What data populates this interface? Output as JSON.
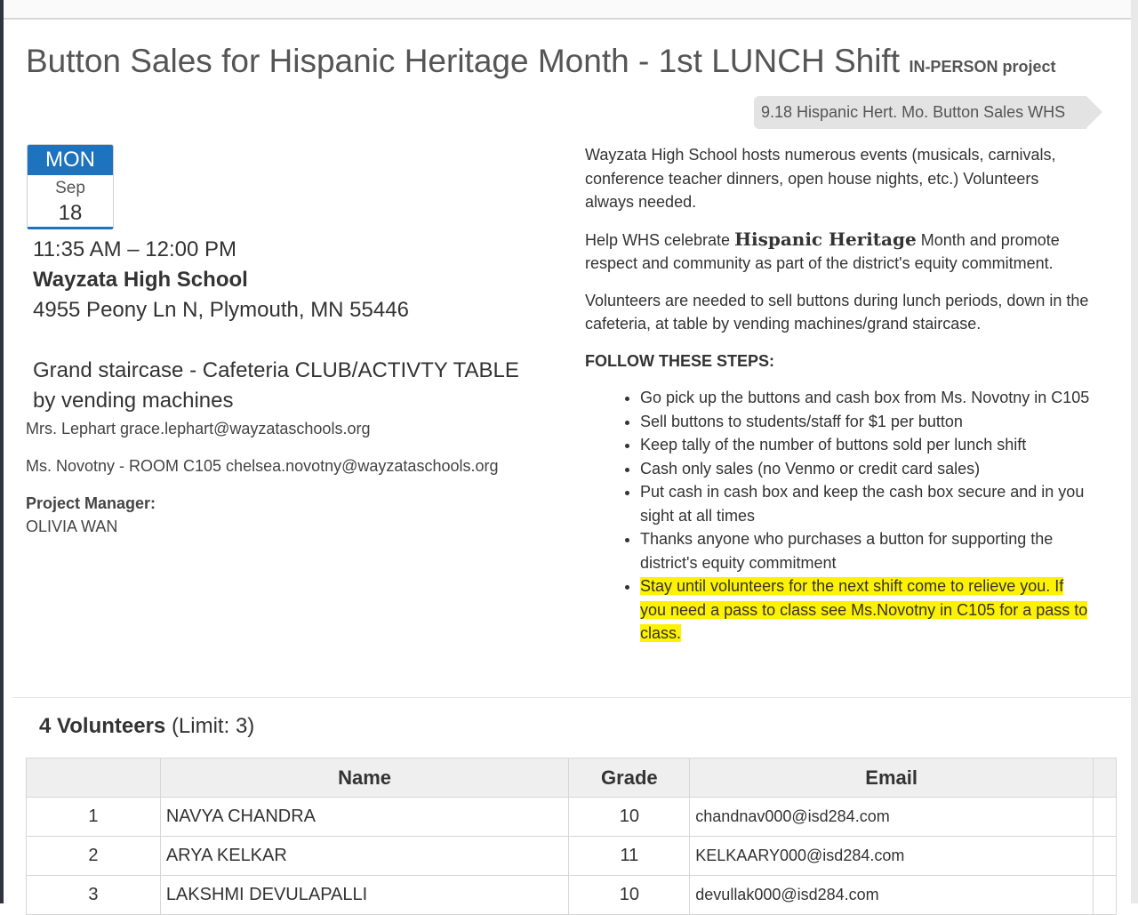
{
  "header": {
    "title": "Button Sales for Hispanic Heritage Month - 1st LUNCH Shift",
    "type_label": "IN-PERSON project",
    "event_tag": "9.18 Hispanic Hert. Mo. Button Sales WHS"
  },
  "date": {
    "day_of_week": "MON",
    "month": "Sep",
    "day": "18"
  },
  "details": {
    "time": "11:35 AM – 12:00 PM",
    "venue": "Wayzata High School",
    "address": "4955 Peony Ln N, Plymouth, MN 55446",
    "location_line1": "Grand staircase - Cafeteria CLUB/ACTIVTY TABLE",
    "location_line2": "by vending machines",
    "contact1": "Mrs. Lephart  grace.lephart@wayzataschools.org",
    "contact2": "Ms. Novotny - ROOM C105  chelsea.novotny@wayzataschools.org",
    "project_manager_label": "Project Manager:",
    "project_manager_name": "OLIVIA WAN"
  },
  "description": {
    "para1": "Wayzata High School hosts numerous events (musicals, carnivals, conference teacher dinners, open house nights, etc.)  Volunteers always needed.",
    "para2_before": "Help WHS celebrate ",
    "para2_emphasis": "Hispanic  Heritage",
    "para2_after": " Month and promote respect and community as part of the district's equity commitment.",
    "para3": "Volunteers are needed to sell buttons during lunch periods, down in the cafeteria, at table by vending machines/grand staircase.",
    "steps_title": "FOLLOW THESE STEPS:",
    "steps": [
      "Go pick up the buttons and cash box from Ms. Novotny in C105",
      "Sell buttons to students/staff for $1 per button",
      "Keep tally of the number of buttons sold per lunch shift",
      "Cash only sales (no Venmo or credit card sales)",
      "Put cash in cash box and keep the cash box secure and in you sight at all times",
      "Thanks anyone who purchases a button for supporting the district's equity commitment",
      "Stay until volunteers for the next shift come to relieve you. If you need a pass to class see Ms.Novotny in C105 for a pass to class."
    ]
  },
  "volunteers": {
    "count_label": "4 Volunteers",
    "limit_label": "(Limit: 3)",
    "columns": [
      "Name",
      "Grade",
      "Email"
    ],
    "rows": [
      {
        "num": "1",
        "name": "NAVYA CHANDRA",
        "grade": "10",
        "email": "chandnav000@isd284.com"
      },
      {
        "num": "2",
        "name": "ARYA KELKAR",
        "grade": "11",
        "email": "KELKAARY000@isd284.com"
      },
      {
        "num": "3",
        "name": "LAKSHMI DEVULAPALLI",
        "grade": "10",
        "email": "devullak000@isd284.com"
      }
    ]
  },
  "colors": {
    "calendar_accent": "#1e73be",
    "highlight": "#fff200",
    "tag_background": "#e3e3e3"
  }
}
